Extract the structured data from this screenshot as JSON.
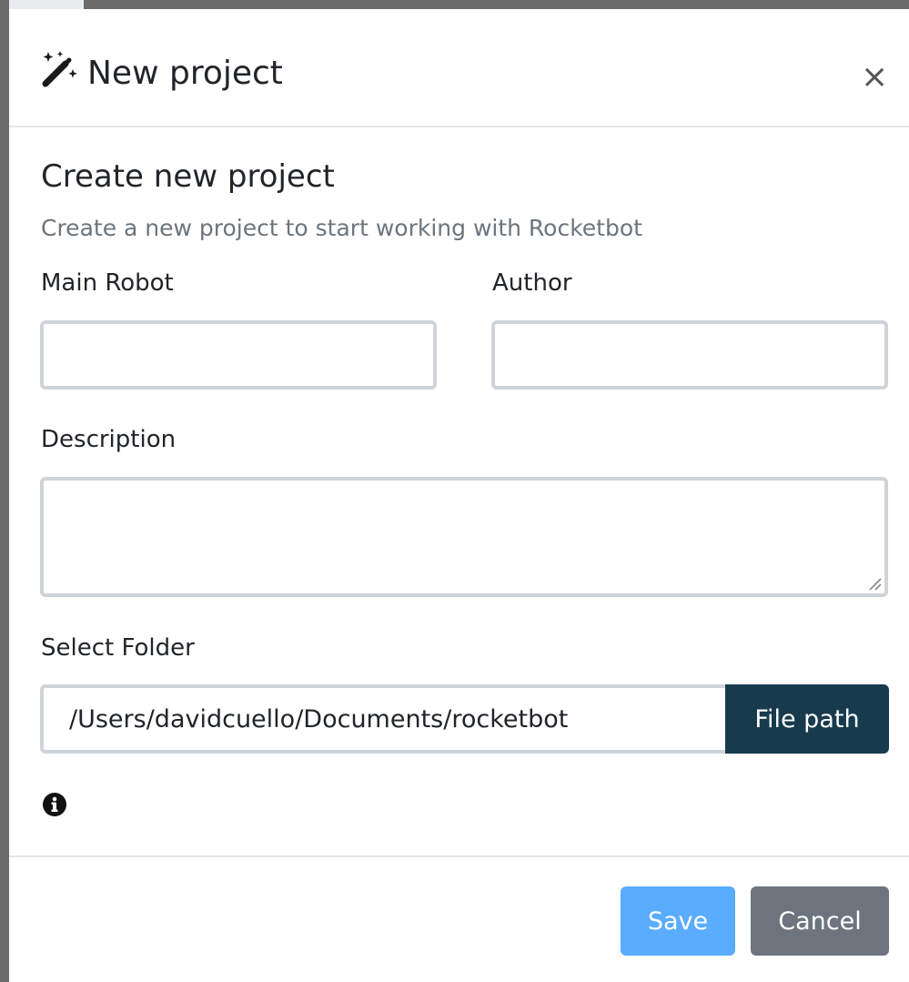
{
  "modal": {
    "title": "New project",
    "close_label": "×",
    "title_icon": "magic-wand-icon"
  },
  "form": {
    "heading": "Create new project",
    "subheading": "Create a new project to start working with Rocketbot",
    "main_robot_label": "Main Robot",
    "main_robot_value": "",
    "author_label": "Author",
    "author_value": "",
    "description_label": "Description",
    "description_value": "",
    "folder_label": "Select Folder",
    "folder_value": "/Users/davidcuello/Documents/rocketbot",
    "file_path_button": "File path",
    "info_icon": "info-circle-icon"
  },
  "footer": {
    "save_label": "Save",
    "cancel_label": "Cancel"
  },
  "colors": {
    "file_path_button": "#183a4d",
    "save_button": "#5aacff",
    "cancel_button": "#6c757d",
    "input_border": "#ced4da"
  }
}
